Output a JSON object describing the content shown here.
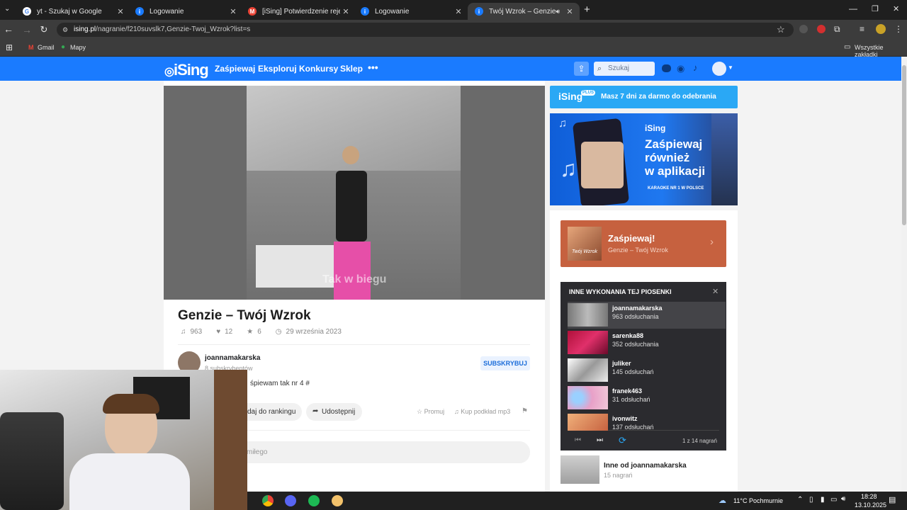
{
  "browser": {
    "tabs": [
      {
        "title": "yt - Szukaj w Google"
      },
      {
        "title": "Logowanie"
      },
      {
        "title": "[iSing] Potwierdzenie rejestracji"
      },
      {
        "title": "Logowanie"
      },
      {
        "title": "Twój Wzrok – Genzie w wyk"
      }
    ],
    "url_host": "ising.pl",
    "url_path": "/nagranie/f210suvslk7,Genzie-Twoj_Wzrok?list=s",
    "bookmarks": [
      "Gmail",
      "Mapy"
    ],
    "all_bookmarks": "Wszystkie zakładki"
  },
  "site": {
    "logo": "iSing",
    "nav": [
      "Zaśpiewaj",
      "Eksploruj",
      "Konkursy",
      "Sklep"
    ],
    "search_placeholder": "Szukaj"
  },
  "video": {
    "caption": "Tak w biegu"
  },
  "song": {
    "title": "Genzie – Twój Wzrok",
    "plays": "963",
    "likes": "12",
    "stars": "6",
    "date": "29 września 2023",
    "user": "joannamakarska",
    "subs": "8 subskrybentów",
    "subscribe": "SUBSKRYBUJ",
    "description": "śpiewam tak nr 4 #",
    "add_ranking": "daj do rankingu",
    "share": "Udostępnij",
    "promote": "Promuj",
    "buy": "Kup podkład mp3",
    "comment_placeholder": "miłego"
  },
  "sidebar": {
    "plus_logo": "iSing",
    "plus_badge": "PLUS",
    "plus_text": "Masz 7 dni za darmo do odebrania",
    "ad_logo": "iSing",
    "ad_line1": "Zaśpiewaj",
    "ad_line2": "również",
    "ad_line3": "w aplikacji",
    "ad_badge": "KARAOKE NR 1 W POLSCE",
    "sing_title": "Zaśpiewaj!",
    "sing_sub": "Genzie – Twój Wzrok",
    "sing_cover": "Twój Wzrok",
    "other_header": "INNE WYKONANIA TEJ PIOSENKI",
    "performances": [
      {
        "name": "joannamakarska",
        "views": "963 odsłuchania"
      },
      {
        "name": "sarenka88",
        "views": "352 odsłuchania"
      },
      {
        "name": "juliker",
        "views": "145 odsłuchań"
      },
      {
        "name": "franek463",
        "views": "31 odsłuchań"
      },
      {
        "name": "ivonwitz",
        "views": "137 odsłuchań"
      }
    ],
    "pager": "1 z 14 nagrań",
    "more_title": "Inne od joannamakarska",
    "more_count": "15 nagrań"
  },
  "taskbar": {
    "weather": "11°C Pochmurnie",
    "time": "18:28",
    "date": "13.10.2025"
  },
  "colors": {
    "brand": "#1a7bff",
    "sing_card": "#c6613f",
    "dark_panel": "#2b2b2f"
  }
}
